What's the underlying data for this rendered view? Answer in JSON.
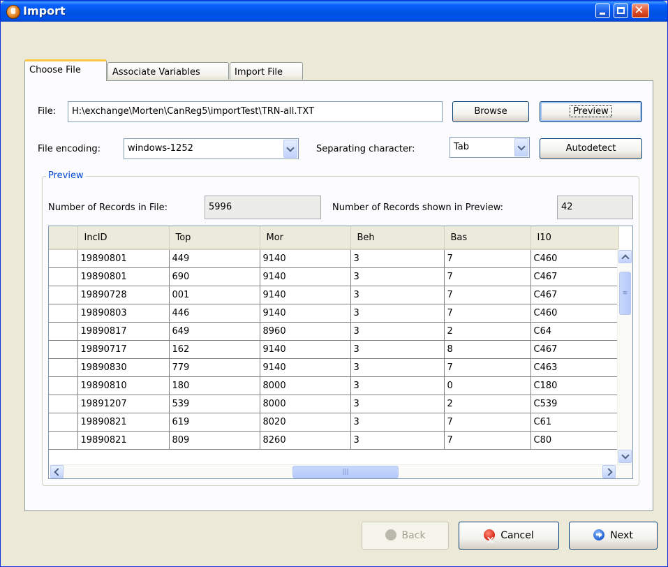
{
  "window": {
    "title": "Import"
  },
  "tabs": [
    {
      "label": "Choose File"
    },
    {
      "label": "Associate Variables"
    },
    {
      "label": "Import File"
    }
  ],
  "file": {
    "label": "File:",
    "path": "H:\\exchange\\Morten\\CanReg5\\importTest\\TRN-all.TXT",
    "browse": "Browse",
    "preview": "Preview"
  },
  "encoding": {
    "label": "File encoding:",
    "value": "windows-1252",
    "sep_label": "Separating character:",
    "sep_value": "Tab",
    "autodetect": "Autodetect"
  },
  "preview": {
    "legend": "Preview",
    "records_label": "Number of Records in File:",
    "records_value": "5996",
    "shown_label": "Number of Records shown in Preview:",
    "shown_value": "42"
  },
  "table": {
    "columns": [
      "IncID",
      "Top",
      "Mor",
      "Beh",
      "Bas",
      "I10"
    ],
    "rows": [
      [
        "19890801",
        "449",
        "9140",
        "3",
        "7",
        "C460"
      ],
      [
        "19890801",
        "690",
        "9140",
        "3",
        "7",
        "C467"
      ],
      [
        "19890728",
        "001",
        "9140",
        "3",
        "7",
        "C467"
      ],
      [
        "19890803",
        "446",
        "9140",
        "3",
        "7",
        "C460"
      ],
      [
        "19890817",
        "649",
        "8960",
        "3",
        "2",
        "C64"
      ],
      [
        "19890717",
        "162",
        "9140",
        "3",
        "8",
        "C467"
      ],
      [
        "19890830",
        "779",
        "9140",
        "3",
        "7",
        "C463"
      ],
      [
        "19890810",
        "180",
        "8000",
        "3",
        "0",
        "C180"
      ],
      [
        "19891207",
        "539",
        "8000",
        "3",
        "2",
        "C539"
      ],
      [
        "19890821",
        "619",
        "8020",
        "3",
        "7",
        "C61"
      ],
      [
        "19890821",
        "809",
        "8260",
        "3",
        "7",
        "C80"
      ]
    ]
  },
  "footer": {
    "back": "Back",
    "cancel": "Cancel",
    "next": "Next"
  }
}
